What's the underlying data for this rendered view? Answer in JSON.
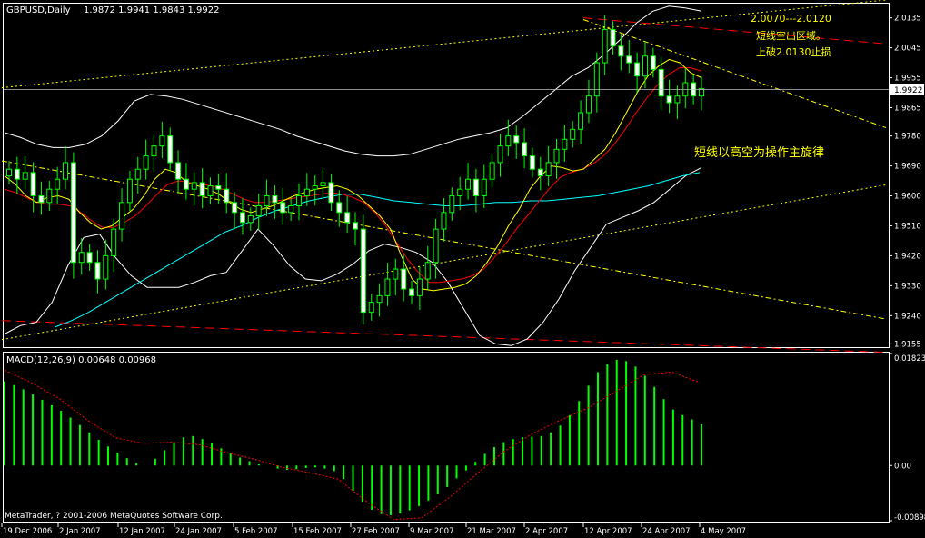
{
  "window": {
    "header_symbol": "GBPUSD,Daily",
    "header_ohlc": "1.9872 1.9941 1.9843 1.9922",
    "macd_title": "MACD(12,26,9) 0.00648 0.00968",
    "copyright": "MetaTrader, ? 2001-2006 MetaQuotes Software Corp."
  },
  "colors": {
    "background": "#000000",
    "frame": "#ffffff",
    "candle_up": "#000000",
    "candle_body_outline": "#00ff00",
    "candle_down_fill": "#ffffff",
    "wick": "#00ff00",
    "ma_fast": "#ffff00",
    "ma_mid": "#ff0000",
    "ma_slow": "#00ffff",
    "bollinger": "#ffffff",
    "trend_red": "#ff0000",
    "trend_yellow": "#ffff00",
    "macd_hist": "#00ff00",
    "macd_signal": "#ff0000",
    "annotation": "#ffff00",
    "price_label_bg": "#ffffff",
    "price_label_text": "#000000"
  },
  "annotations": {
    "zone": "2.0070---2.0120",
    "short_line": "短线空出区域。",
    "stop": "上破2.0130止损",
    "strategy": "短线以高空为操作主旋律"
  },
  "chart_data": [
    {
      "type": "candlestick",
      "title": "GBPUSD,Daily",
      "ylim": [
        1.9148,
        2.0175
      ],
      "y_ticks": [
        "2.0135",
        "2.0045",
        "1.9955",
        "1.9865",
        "1.9780",
        "1.9690",
        "1.9600",
        "1.9510",
        "1.9420",
        "1.9330",
        "1.9240",
        "1.9155"
      ],
      "x_ticks": [
        "19 Dec 2006",
        "2 Jan 2007",
        "12 Jan 2007",
        "24 Jan 2007",
        "5 Feb 2007",
        "15 Feb 2007",
        "27 Feb 2007",
        "9 Mar 2007",
        "21 Mar 2007",
        "2 Apr 2007",
        "12 Apr 2007",
        "24 Apr 2007",
        "4 May 2007"
      ],
      "current_price": "1.9922",
      "closes": [
        1.968,
        1.965,
        1.967,
        1.96,
        1.958,
        1.962,
        1.965,
        1.97,
        1.94,
        1.943,
        1.94,
        1.935,
        1.942,
        1.95,
        1.958,
        1.965,
        1.968,
        1.972,
        1.975,
        1.978,
        1.97,
        1.965,
        1.962,
        1.964,
        1.96,
        1.963,
        1.962,
        1.958,
        1.955,
        1.952,
        1.954,
        1.957,
        1.96,
        1.958,
        1.955,
        1.957,
        1.96,
        1.962,
        1.963,
        1.964,
        1.958,
        1.955,
        1.952,
        1.95,
        1.925,
        1.928,
        1.93,
        1.935,
        1.938,
        1.932,
        1.93,
        1.935,
        1.94,
        1.95,
        1.955,
        1.96,
        1.962,
        1.965,
        1.96,
        1.965,
        1.97,
        1.975,
        1.978,
        1.976,
        1.972,
        1.968,
        1.966,
        1.97,
        1.974,
        1.977,
        1.98,
        1.985,
        1.99,
        2.0,
        2.01,
        2.005,
        2.002,
        2.0,
        1.996,
        2.002,
        1.998,
        1.99,
        1.988,
        1.99,
        1.994,
        1.99,
        1.9922
      ],
      "ma_fast": [
        1.966,
        1.9635,
        1.96,
        1.958,
        1.9595,
        1.96,
        1.959,
        1.955,
        1.952,
        1.95,
        1.951,
        1.9535,
        1.956,
        1.96,
        1.965,
        1.968,
        1.967,
        1.964,
        1.963,
        1.962,
        1.9605,
        1.958,
        1.956,
        1.955,
        1.956,
        1.957,
        1.9585,
        1.96,
        1.961,
        1.962,
        1.9625,
        1.963,
        1.962,
        1.96,
        1.957,
        1.954,
        1.95,
        1.942,
        1.935,
        1.932,
        1.9315,
        1.932,
        1.9325,
        1.9335,
        1.936,
        1.94,
        1.945,
        1.951,
        1.956,
        1.962,
        1.966,
        1.969,
        1.9685,
        1.9675,
        1.968,
        1.971,
        1.974,
        1.979,
        1.985,
        1.991,
        1.996,
        1.999,
        2.001,
        2.0,
        1.997,
        1.9955
      ],
      "ma_mid": [
        1.962,
        1.961,
        1.9595,
        1.958,
        1.9575,
        1.9575,
        1.957,
        1.955,
        1.9525,
        1.9505,
        1.9505,
        1.952,
        1.954,
        1.957,
        1.9605,
        1.9635,
        1.9645,
        1.964,
        1.9635,
        1.963,
        1.962,
        1.9605,
        1.959,
        1.958,
        1.958,
        1.9585,
        1.959,
        1.9595,
        1.96,
        1.9605,
        1.961,
        1.9605,
        1.9595,
        1.958,
        1.955,
        1.951,
        1.946,
        1.941,
        1.937,
        1.934,
        1.934,
        1.9345,
        1.935,
        1.936,
        1.938,
        1.9415,
        1.9455,
        1.95,
        1.954,
        1.958,
        1.962,
        1.9655,
        1.967,
        1.968,
        1.9695,
        1.972,
        1.9755,
        1.98,
        1.985,
        1.9895,
        1.9935,
        1.9965,
        1.9985,
        1.9985,
        1.9975
      ],
      "ma_slow": [
        1.9205,
        1.9225,
        1.925,
        1.928,
        1.931,
        1.934,
        1.937,
        1.94,
        1.943,
        1.946,
        1.949,
        1.951,
        1.9535,
        1.9555,
        1.957,
        1.9585,
        1.9595,
        1.9605,
        1.9605,
        1.9595,
        1.9585,
        1.958,
        1.9575,
        1.957,
        1.957,
        1.9575,
        1.958,
        1.958,
        1.9585,
        1.9585,
        1.959,
        1.9595,
        1.96,
        1.961,
        1.962,
        1.963,
        1.9645,
        1.966,
        1.967
      ],
      "bb_upper": [
        1.979,
        1.9775,
        1.9755,
        1.9745,
        1.9745,
        1.9755,
        1.978,
        1.9825,
        1.9885,
        1.9905,
        1.99,
        1.989,
        1.9875,
        1.986,
        1.9845,
        1.983,
        1.9815,
        1.98,
        1.978,
        1.9765,
        1.975,
        1.9735,
        1.9725,
        1.972,
        1.972,
        1.9725,
        1.974,
        1.9755,
        1.977,
        1.978,
        1.979,
        1.9805,
        1.984,
        1.988,
        1.992,
        1.996,
        1.9985,
        2.0025,
        2.007,
        2.012,
        2.0155,
        2.017,
        2.0165,
        2.0155
      ],
      "bb_lower": [
        1.9185,
        1.921,
        1.922,
        1.928,
        1.939,
        1.9475,
        1.9485,
        1.9415,
        1.936,
        1.9325,
        1.9325,
        1.9325,
        1.934,
        1.936,
        1.937,
        1.9435,
        1.95,
        1.945,
        1.939,
        1.935,
        1.9345,
        1.9365,
        1.9395,
        1.9435,
        1.9455,
        1.9445,
        1.943,
        1.94,
        1.934,
        1.926,
        1.918,
        1.9155,
        1.915,
        1.917,
        1.922,
        1.929,
        1.9375,
        1.9445,
        1.9515,
        1.9535,
        1.9555,
        1.958,
        1.962,
        1.966,
        1.9685
      ],
      "trendlines": [
        {
          "name": "upper-channel-yellow",
          "color": "yellow",
          "style": "dotted",
          "from": [
            "19 Dec 2006",
            1.9925
          ],
          "to": [
            "2 May 2007",
            2.0175
          ]
        },
        {
          "name": "lower-channel-yellow",
          "color": "yellow",
          "style": "dotted",
          "from": [
            "19 Dec 2006",
            1.9168
          ],
          "to": [
            "4 May 2007",
            1.9535
          ]
        },
        {
          "name": "falling-yellow",
          "color": "yellow",
          "style": "dash-dot",
          "from": [
            "19 Dec 2006",
            1.9705
          ],
          "to": [
            "4 May 2007",
            1.933
          ]
        },
        {
          "name": "falling-yellow-short",
          "color": "yellow",
          "style": "dash-dot",
          "from": [
            "12 Apr 2007",
            2.013
          ],
          "to": [
            "4 May 2007",
            2.0005
          ]
        },
        {
          "name": "red-top",
          "color": "red",
          "style": "dashed",
          "from": [
            "12 Apr 2007",
            2.0135
          ],
          "to": [
            "4 May 2007",
            2.0105
          ]
        },
        {
          "name": "red-bottom",
          "color": "red",
          "style": "dashed",
          "from": [
            "19 Dec 2006",
            1.9225
          ],
          "to": [
            "4 May 2007",
            1.915
          ]
        }
      ]
    },
    {
      "type": "histogram",
      "title": "MACD(12,26,9) 0.00648 0.00968",
      "ylim": [
        -0.00898,
        0.01823
      ],
      "y_ticks": [
        "0.01823",
        "0.00",
        "-0.00898"
      ],
      "series": [
        {
          "name": "MACD",
          "values": [
            0.0137,
            0.0131,
            0.0124,
            0.0116,
            0.0107,
            0.0098,
            0.0089,
            0.0078,
            0.0066,
            0.0054,
            0.0042,
            0.0031,
            0.0021,
            0.0012,
            0.0004,
            0.0,
            0.0011,
            0.0025,
            0.0037,
            0.0046,
            0.0048,
            0.0043,
            0.0036,
            0.0028,
            0.002,
            0.0013,
            0.0007,
            0.0002,
            0.0,
            -0.0005,
            -0.0007,
            -0.0006,
            -0.0004,
            -0.0003,
            -0.0005,
            -0.0009,
            -0.0022,
            -0.0041,
            -0.0059,
            -0.0072,
            -0.0079,
            -0.0081,
            -0.0078,
            -0.0073,
            -0.0066,
            -0.0057,
            -0.0047,
            -0.0035,
            -0.0021,
            -0.0008,
            0.0006,
            0.0019,
            0.003,
            0.0038,
            0.0043,
            0.0046,
            0.0047,
            0.0048,
            0.0054,
            0.0065,
            0.0082,
            0.0105,
            0.013,
            0.0152,
            0.0165,
            0.0172,
            0.017,
            0.0161,
            0.0146,
            0.0128,
            0.0108,
            0.0091,
            0.0082,
            0.0075,
            0.0067
          ]
        },
        {
          "name": "Signal",
          "values": [
            0.0155,
            0.0134,
            0.0108,
            0.0073,
            0.0045,
            0.0036,
            0.0038,
            0.0034,
            0.0021,
            0.001,
            -0.0003,
            -0.0012,
            -0.0022,
            -0.0058,
            -0.0088,
            -0.0085,
            -0.0052,
            -0.0013,
            0.0024,
            0.0052,
            0.0074,
            0.0094,
            0.0121,
            0.0148,
            0.0152,
            0.0135
          ]
        }
      ]
    }
  ]
}
